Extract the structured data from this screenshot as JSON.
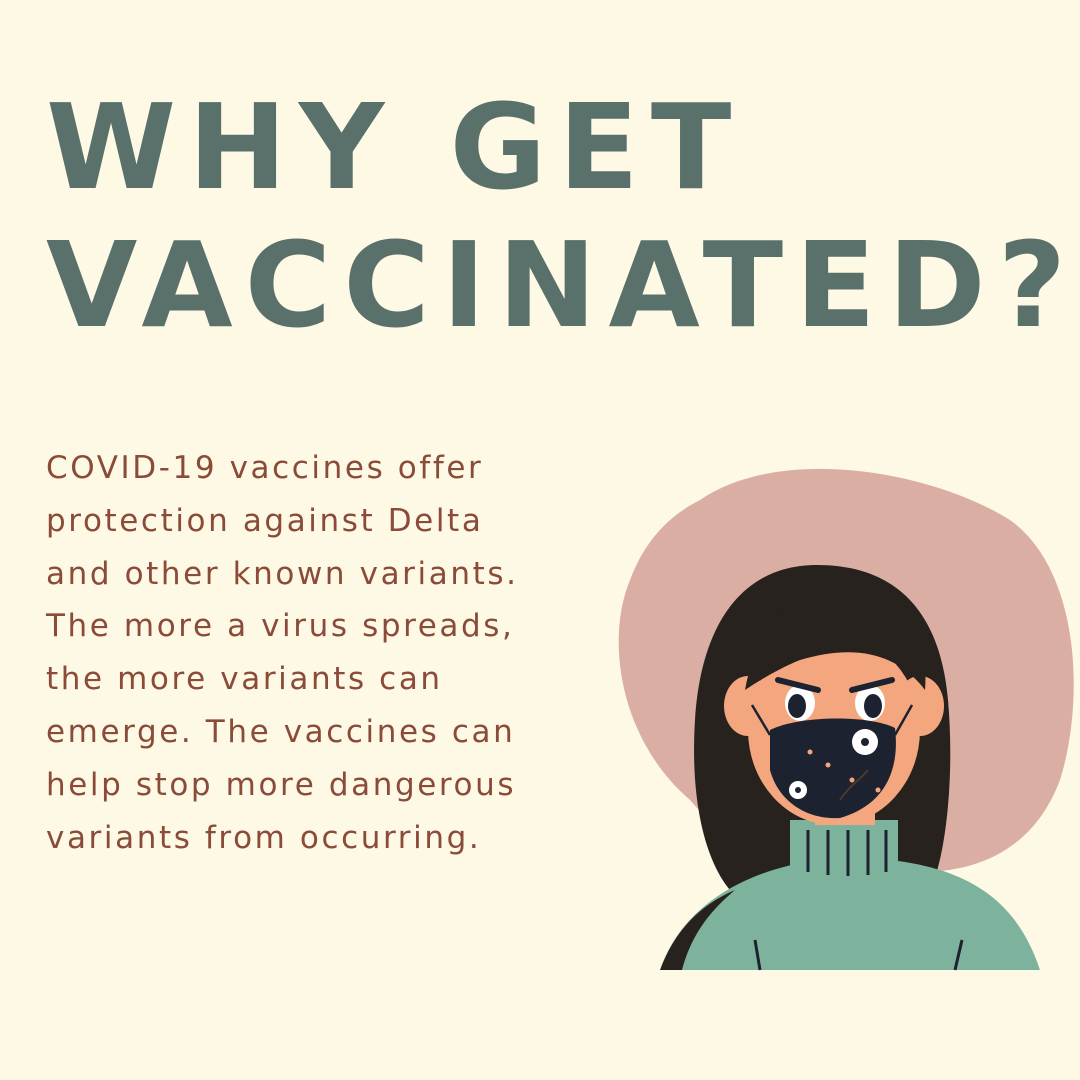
{
  "headline": {
    "lines": [
      "WHY GET",
      "VACCINATED?"
    ],
    "color": "#5a716b"
  },
  "body": {
    "lines": [
      "COVID-19 vaccines offer",
      "protection against Delta",
      "and other known variants.",
      "The more a virus spreads,",
      "the more variants can",
      "emerge. The vaccines can",
      "help stop more dangerous",
      "variants from occurring."
    ],
    "color": "#8a4b39"
  },
  "colors": {
    "background": "#fef9e5",
    "blob": "#dbaea4",
    "hair": "#28221f",
    "skin": "#f4a67e",
    "mask": "#1d2230",
    "sweater": "#7db39c"
  },
  "illustration": {
    "icon": "masked-woman-illustration"
  }
}
